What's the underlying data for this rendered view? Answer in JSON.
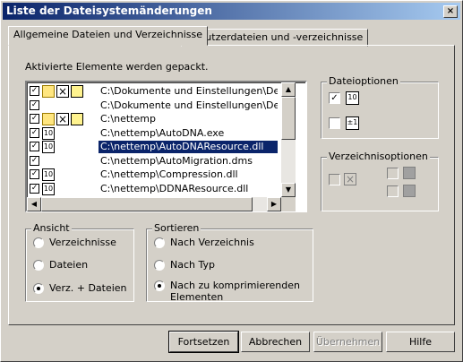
{
  "window": {
    "title": "Liste der Dateisystemänderungen",
    "close_glyph": "×"
  },
  "tabs": [
    {
      "label": "Allgemeine Dateien und Verzeichnisse",
      "active": true
    },
    {
      "label": "Benutzerdateien und -verzeichnisse",
      "active": false
    }
  ],
  "intro_text": "Aktivierte Elemente werden gepackt.",
  "list": {
    "rows": [
      {
        "path": "C:\\Dokumente und Einstellungen\\Default User",
        "icons": [
          "folder-icon",
          "x-icon",
          "folders-icon"
        ]
      },
      {
        "path": "C:\\Dokumente und Einstellungen\\Default User",
        "icons": []
      },
      {
        "path": "C:\\nettemp",
        "icons": [
          "folder-icon",
          "x-icon",
          "folders-icon"
        ]
      },
      {
        "path": "C:\\nettemp\\AutoDNA.exe",
        "icons": [
          "binary-icon"
        ]
      },
      {
        "path": "C:\\nettemp\\AutoDNAResource.dll",
        "icons": [
          "binary-icon"
        ],
        "selected": true
      },
      {
        "path": "C:\\nettemp\\AutoMigration.dms",
        "icons": []
      },
      {
        "path": "C:\\nettemp\\Compression.dll",
        "icons": [
          "binary-icon"
        ]
      },
      {
        "path": "C:\\nettemp\\DDNAResource.dll",
        "icons": [
          "binary-icon"
        ]
      }
    ],
    "binary_glyph": "10",
    "check_glyph": "✓",
    "x_glyph": "×"
  },
  "dateioptionen": {
    "title": "Dateioptionen",
    "binary_glyph": "10",
    "num_glyph": "±1"
  },
  "verzeichnisoptionen": {
    "title": "Verzeichnisoptionen"
  },
  "ansicht": {
    "title": "Ansicht",
    "options": [
      "Verzeichnisse",
      "Dateien",
      "Verz. + Dateien"
    ],
    "selected": 2
  },
  "sortieren": {
    "title": "Sortieren",
    "options": [
      "Nach Verzeichnis",
      "Nach Typ",
      "Nach zu komprimierenden Elementen"
    ],
    "selected": 2
  },
  "buttons": {
    "continue": "Fortsetzen",
    "cancel": "Abbrechen",
    "apply": "Übernehmen",
    "help": "Hilfe"
  },
  "scroll_glyphs": {
    "up": "▲",
    "down": "▼",
    "left": "◀",
    "right": "▶"
  }
}
